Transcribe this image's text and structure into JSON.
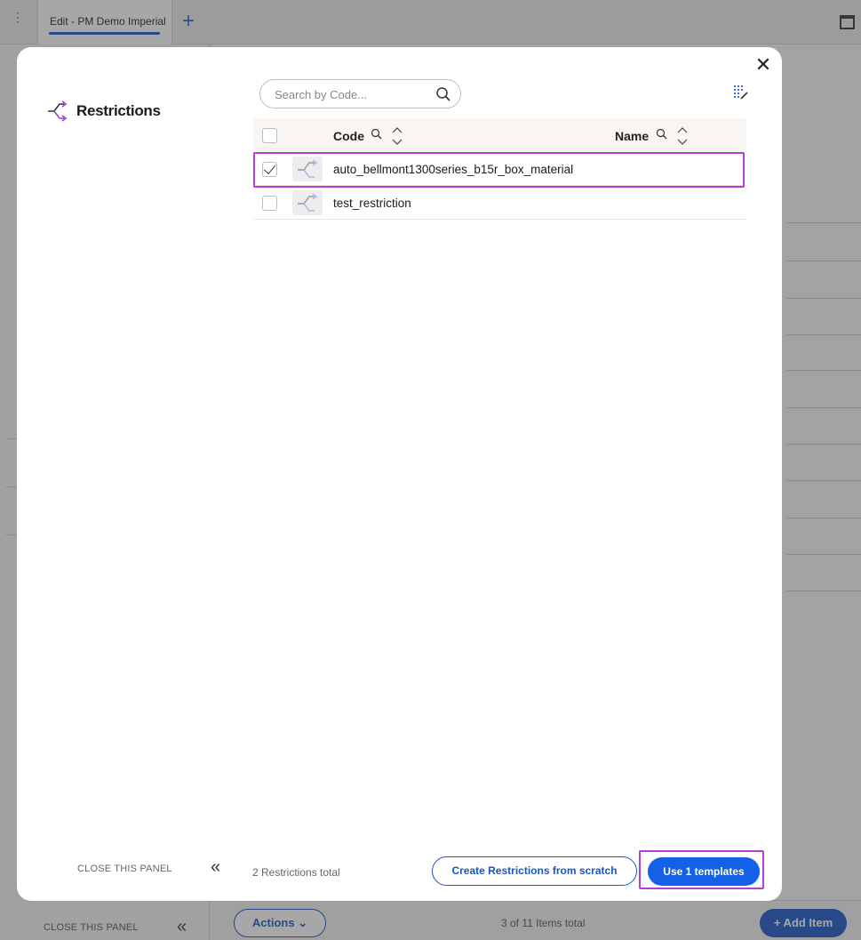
{
  "topbar": {
    "tab_label": "Edit - PM Demo Imperial",
    "add_tab_icon": "plus-icon",
    "window_icon": "window-icon"
  },
  "background": {
    "left_close_label": "CLOSE THIS PANEL",
    "actions_label": "Actions",
    "items_total": "3 of 11 Items total",
    "add_item_label": "+ Add Item"
  },
  "modal": {
    "title": "Restrictions",
    "title_icon": "restriction-branch-icon",
    "search_placeholder": "Search by Code...",
    "columns": [
      {
        "label": "Code"
      },
      {
        "label": "Name"
      }
    ],
    "rows": [
      {
        "code": "auto_bellmont1300series_b15r_box_material",
        "checked": true
      },
      {
        "code": "test_restriction",
        "checked": false
      }
    ],
    "close_panel_label": "CLOSE THIS PANEL",
    "total_label": "2 Restrictions total",
    "create_button": "Create Restrictions from scratch",
    "use_button": "Use 1 templates"
  },
  "colors": {
    "accent": "#1460e6",
    "highlight": "#b43ed6",
    "icon_purple": "#9a3fd0"
  }
}
